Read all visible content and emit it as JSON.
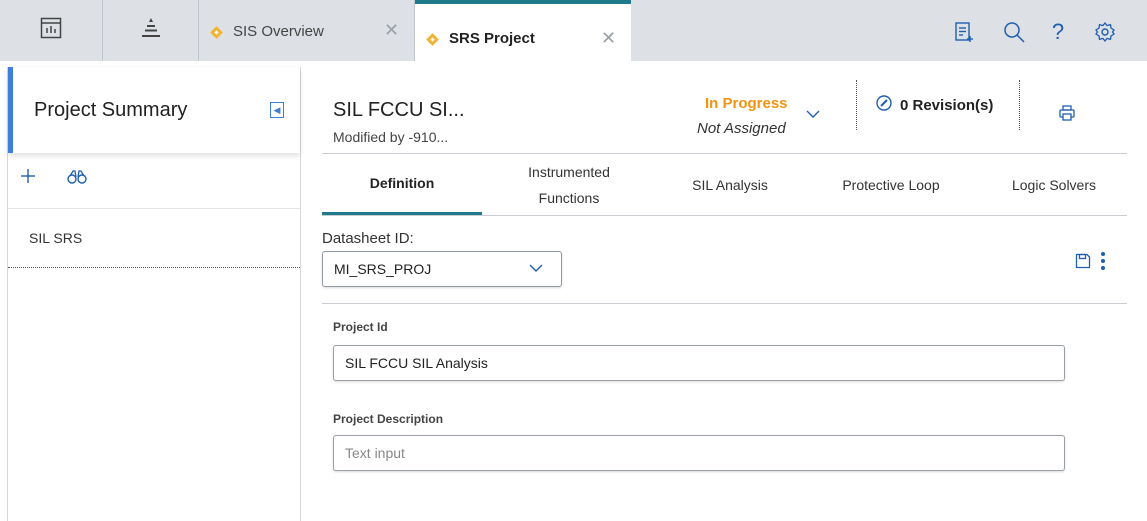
{
  "top_tabs": [
    {
      "label": "SIS Overview",
      "icon": "diamond-icon",
      "active": false
    },
    {
      "label": "SRS Project",
      "icon": "diamond-icon",
      "active": true
    }
  ],
  "app_icons": [
    "dashboard-icon",
    "pyramid-icon"
  ],
  "toolbar_icons": [
    "clipboard-add-icon",
    "search-icon",
    "help-icon",
    "gear-icon"
  ],
  "colors": {
    "accent_teal": "#1f7a8c",
    "accent_blue": "#3f7fd9",
    "status_orange": "#f29411",
    "tab_diamond": "#f2b233"
  },
  "left_panel": {
    "title": "Project Summary",
    "items": [
      {
        "label": "SIL SRS"
      }
    ]
  },
  "record": {
    "title": "SIL FCCU SI...",
    "subtitle": "Modified by -910...",
    "status": "In Progress",
    "assignment": "Not Assigned",
    "revisions": "0 Revision(s)"
  },
  "sub_tabs": [
    {
      "label": "Definition",
      "active": true
    },
    {
      "label": "Instrumented\nFunctions",
      "active": false
    },
    {
      "label": "SIL Analysis",
      "active": false
    },
    {
      "label": "Protective Loop",
      "active": false
    },
    {
      "label": "Logic Solvers",
      "active": false
    }
  ],
  "datasheet": {
    "label": "Datasheet ID:",
    "value": "MI_SRS_PROJ"
  },
  "form": {
    "project_id": {
      "label": "Project Id",
      "value": "SIL FCCU SIL Analysis"
    },
    "project_description": {
      "label": "Project Description",
      "placeholder": "Text input"
    }
  }
}
